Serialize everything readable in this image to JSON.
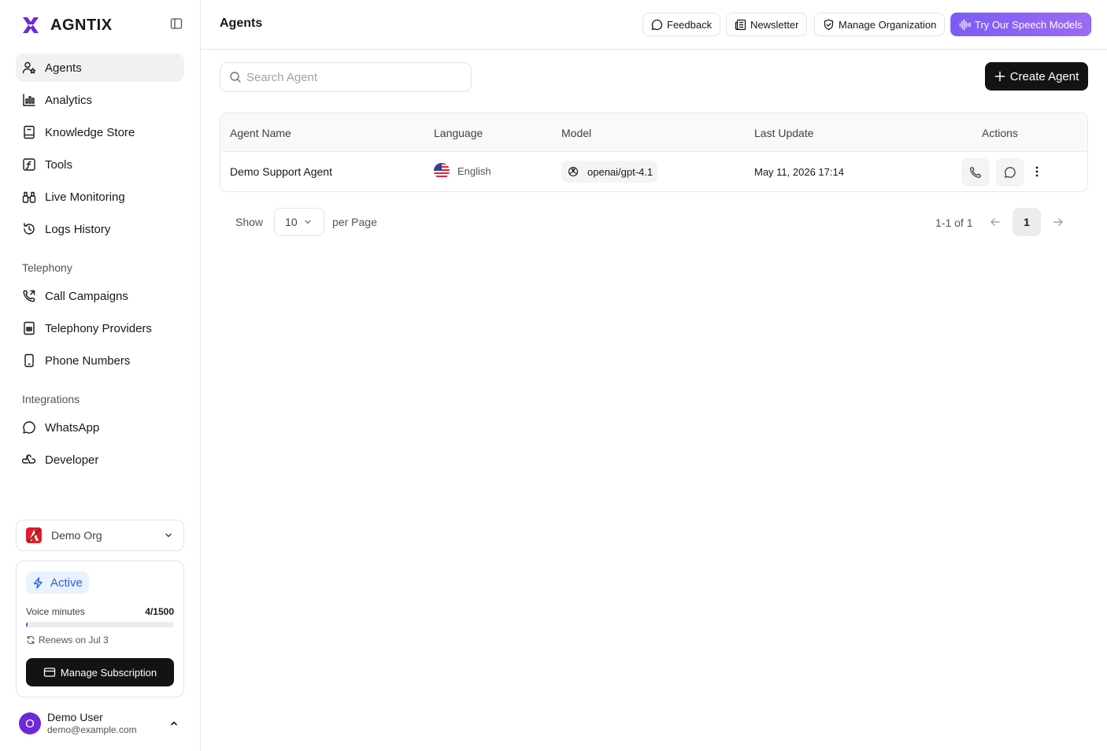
{
  "brand": {
    "name": "AGNTIX",
    "accent": "#6d28d9"
  },
  "sidebar": {
    "items": [
      {
        "label": "Agents",
        "icon": "user-star-icon",
        "active": true
      },
      {
        "label": "Analytics",
        "icon": "bar-chart-icon"
      },
      {
        "label": "Knowledge Store",
        "icon": "book-icon"
      },
      {
        "label": "Tools",
        "icon": "function-icon"
      },
      {
        "label": "Live Monitoring",
        "icon": "binoculars-icon"
      },
      {
        "label": "Logs History",
        "icon": "history-icon"
      }
    ],
    "telephony_label": "Telephony",
    "telephony_items": [
      {
        "label": "Call Campaigns",
        "icon": "phone-outgoing-icon"
      },
      {
        "label": "Telephony Providers",
        "icon": "building-icon"
      },
      {
        "label": "Phone Numbers",
        "icon": "smartphone-icon"
      }
    ],
    "integrations_label": "Integrations",
    "integrations_items": [
      {
        "label": "WhatsApp",
        "icon": "chat-bubble-icon"
      },
      {
        "label": "Developer",
        "icon": "webhook-icon"
      }
    ],
    "org": {
      "name": "Demo Org"
    },
    "plan": {
      "status": "Active",
      "usage_label": "Voice minutes",
      "usage_value": "4/1500",
      "usage_fraction": 0.0027,
      "renew_text": "Renews on Jul 3",
      "manage_label": "Manage Subscription"
    },
    "user": {
      "initial": "O",
      "name": "Demo User",
      "email": "demo@example.com"
    }
  },
  "header": {
    "title": "Agents",
    "feedback": "Feedback",
    "newsletter": "Newsletter",
    "manage_org": "Manage Organization",
    "speech_models": "Try Our Speech Models"
  },
  "main": {
    "search_placeholder": "Search Agent",
    "create_label": "Create Agent",
    "table": {
      "headers": [
        "Agent Name",
        "Language",
        "Model",
        "Last Update",
        "Actions"
      ],
      "rows": [
        {
          "name": "Demo Support Agent",
          "language": "English",
          "model": "openai/gpt-4.1",
          "last_update": "May 11, 2026 17:14"
        }
      ]
    },
    "pagination": {
      "show_label": "Show",
      "page_size": "10",
      "per_page_label": "per Page",
      "range": "1-1 of 1",
      "current_page": "1"
    }
  }
}
